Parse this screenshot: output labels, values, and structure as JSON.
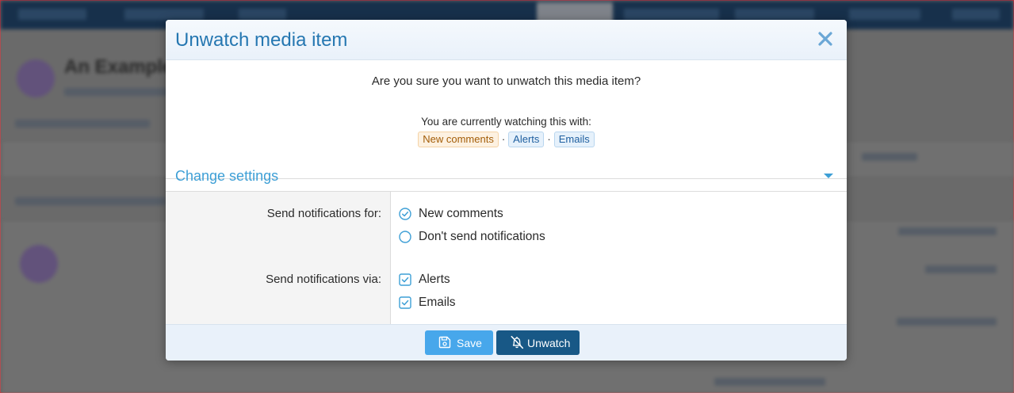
{
  "background": {
    "page_title": "An Example"
  },
  "modal": {
    "title": "Unwatch media item",
    "question": "Are you sure you want to unwatch this media item?",
    "watching_text": "You are currently watching this with:",
    "watching_tags": [
      "New comments",
      "Alerts",
      "Emails"
    ],
    "separator": "·",
    "change_settings": "Change settings",
    "notify_for_label": "Send notifications for:",
    "notify_for_options": [
      {
        "label": "New comments",
        "selected": true
      },
      {
        "label": "Don't send notifications",
        "selected": false
      }
    ],
    "notify_via_label": "Send notifications via:",
    "notify_via_options": [
      {
        "label": "Alerts",
        "checked": true
      },
      {
        "label": "Emails",
        "checked": true
      }
    ],
    "save_label": "Save",
    "unwatch_label": "Unwatch"
  },
  "icons": {
    "close": "close-icon",
    "caret": "chevron-down-icon",
    "save": "save-icon",
    "unwatch": "bell-slash-icon"
  },
  "colors": {
    "accent": "#2577b1",
    "link": "#3d9fd6",
    "save_button": "#47a7eb",
    "unwatch_button": "#185886"
  }
}
